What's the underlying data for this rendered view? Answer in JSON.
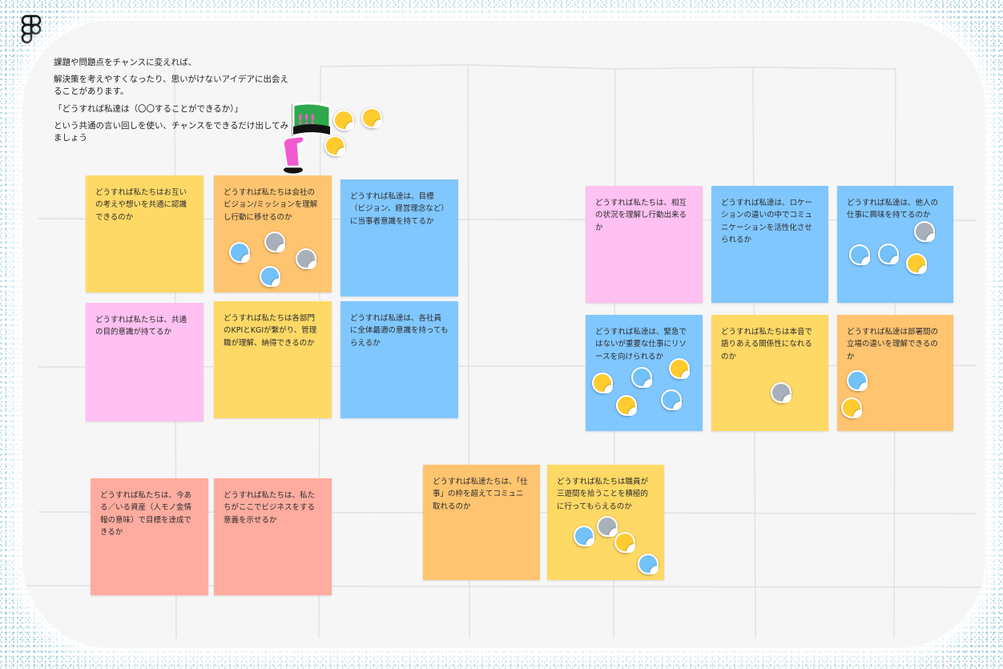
{
  "app": {
    "logo_icon": "figma-logo-icon"
  },
  "intro": {
    "lines": [
      "課題や問題点をチャンスに変えれば、",
      "解決策を考えやすくなったり、思いがけないアイデアに出会えることがあります。",
      "「どうすれば私達は（〇〇することができるか）」",
      "という共通の言い回しを使い、チャンスをできるだけ出してみましょう"
    ]
  },
  "colors": {
    "yellow": "#ffd966",
    "orange": "#ffc470",
    "blue": "#80c7ff",
    "pink": "#ffc0f2",
    "salmon": "#ffaca0",
    "sticker_blue": "#72c1f8",
    "sticker_gray": "#a8b0bc",
    "sticker_yellow": "#ffcb2e"
  },
  "notes": [
    {
      "text": "どうすれば私たちはお互いの考えや想いを共通に認識できるのか"
    },
    {
      "text": "どうすれば私たちは会社のビジョン/ミッションを理解し行動に移せるのか"
    },
    {
      "text": "どうすれば私達は、目標（ビジョン、経営理念など）に当事者意識を持てるか"
    },
    {
      "text": "どうすれば私たちは、共通の目的意識が持てるか"
    },
    {
      "text": "どうすれば私たちは各部門のKPIとKGIが繋がり、管理職が理解、納得できるのか"
    },
    {
      "text": "どうすれば私達は、各社員に全体最適の意識を持ってもらえるか"
    },
    {
      "text": "どうすれば私たちは、今ある／いる資産（人モノ金情報の意味）で目標を達成できるか"
    },
    {
      "text": "どうすれば私たちは、私たちがここでビジネスをする意義を示せるか"
    },
    {
      "text": "どうすれば私達たちは、「仕事」の枠を超えてコミュニ取れるのか"
    },
    {
      "text": "どうすれば私たちは職員が三遊間を拾うことを積極的に行ってもらえるのか"
    },
    {
      "text": "どうすれば私たちは、相互の状況を理解し行動出来るか"
    },
    {
      "text": "どうすれば私達は、ロケーションの違いの中でコミュニケーションを活性化させられるか"
    },
    {
      "text": "どうすれば私達は、他人の仕事に興味を持てるのか"
    },
    {
      "text": "どうすれば私達は、緊急ではないが重要な仕事にリソースを向けられるか"
    },
    {
      "text": "どうすれば私たちは本音で語りあえる関係性になれるのか"
    },
    {
      "text": "どうすれば私達は部署間の立場の違いを理解できるのか"
    }
  ],
  "stickers": {
    "icon": "vote-sticker-icon",
    "flag_icon": "hand-flag-sticker-icon",
    "flag_text": "!!!"
  }
}
